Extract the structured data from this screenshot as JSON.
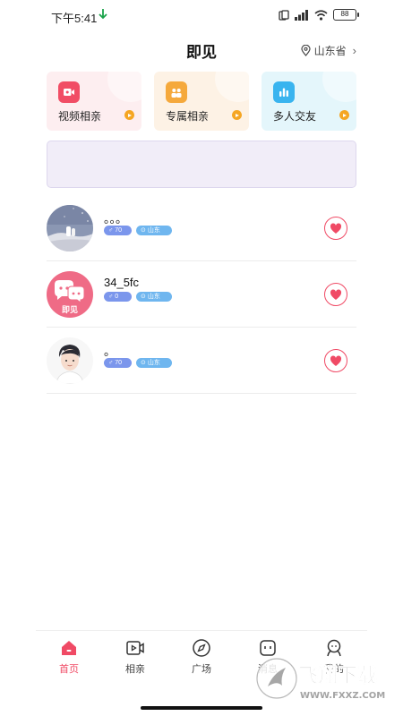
{
  "status_bar": {
    "time": "下午5:41",
    "battery": "88"
  },
  "header": {
    "title": "即见",
    "location": "山东省"
  },
  "categories": [
    {
      "label": "视频相亲",
      "icon": "video-camera-icon"
    },
    {
      "label": "专属相亲",
      "icon": "people-icon"
    },
    {
      "label": "多人交友",
      "icon": "bar-chart-icon"
    }
  ],
  "users": [
    {
      "name": "。。。",
      "gender_age": "70",
      "region": "山东",
      "avatar": "night-scene-avatar"
    },
    {
      "name": "34_5fc",
      "gender_age": "0",
      "region": "山东",
      "avatar": "app-logo-avatar",
      "avatar_text": "即见"
    },
    {
      "name": "。",
      "gender_age": "70",
      "region": "山东",
      "avatar": "boy-cartoon-avatar"
    }
  ],
  "nav": [
    {
      "label": "首页",
      "icon": "home-icon",
      "active": true
    },
    {
      "label": "相亲",
      "icon": "video-icon",
      "active": false
    },
    {
      "label": "广场",
      "icon": "compass-icon",
      "active": false
    },
    {
      "label": "消息",
      "icon": "message-icon",
      "active": false
    },
    {
      "label": "我的",
      "icon": "profile-icon",
      "active": false
    }
  ],
  "watermark": {
    "brand": "飞翔下载",
    "url": "WWW.FXXZ.COM"
  },
  "colors": {
    "accent": "#f04a65",
    "gender_tag": "#7b96ec",
    "region_tag": "#6fb6ef"
  }
}
